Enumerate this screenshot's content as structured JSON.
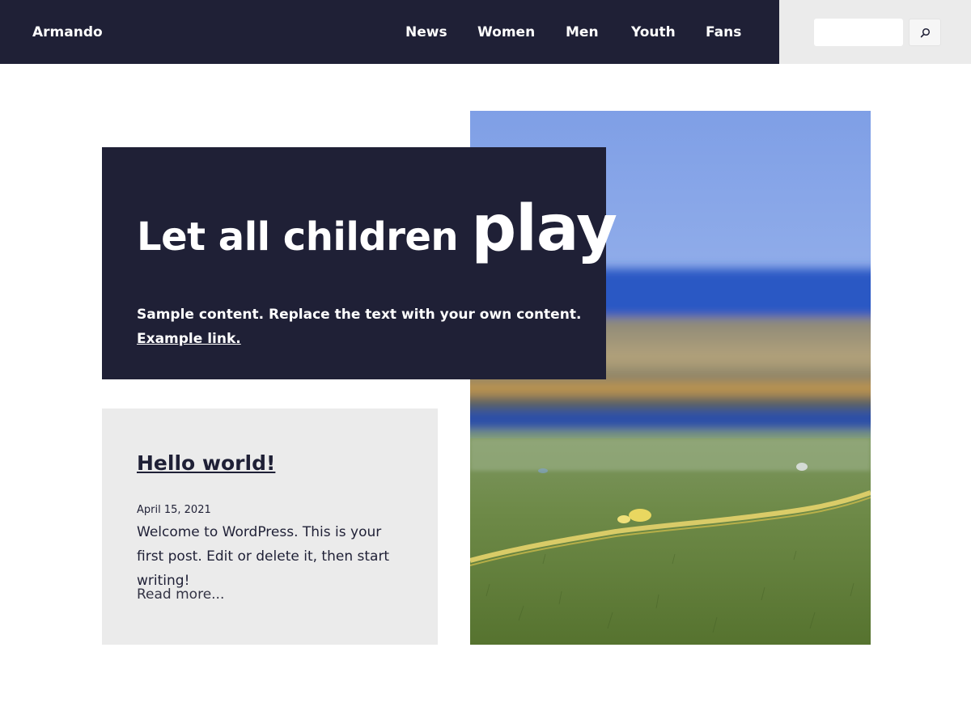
{
  "header": {
    "site_title": "Armando",
    "nav": {
      "news": "News",
      "women": "Women",
      "men": "Men",
      "youth": "Youth",
      "fans": "Fans"
    },
    "search": {
      "value": "",
      "placeholder": "",
      "icon": "search-icon"
    }
  },
  "hero": {
    "heading_part1": "Let all children ",
    "heading_part2": "play",
    "text": "Sample content. Replace the text with your own content.",
    "link_label": "Example link."
  },
  "post": {
    "title": "Hello world!",
    "date": "April 15, 2021",
    "excerpt": "Welcome to WordPress. This is your first post. Edit or delete it, then start writing!",
    "read_more": "Read more..."
  },
  "colors": {
    "primary_dark": "#1f2036",
    "light_gray": "#ebebeb",
    "white": "#ffffff"
  }
}
